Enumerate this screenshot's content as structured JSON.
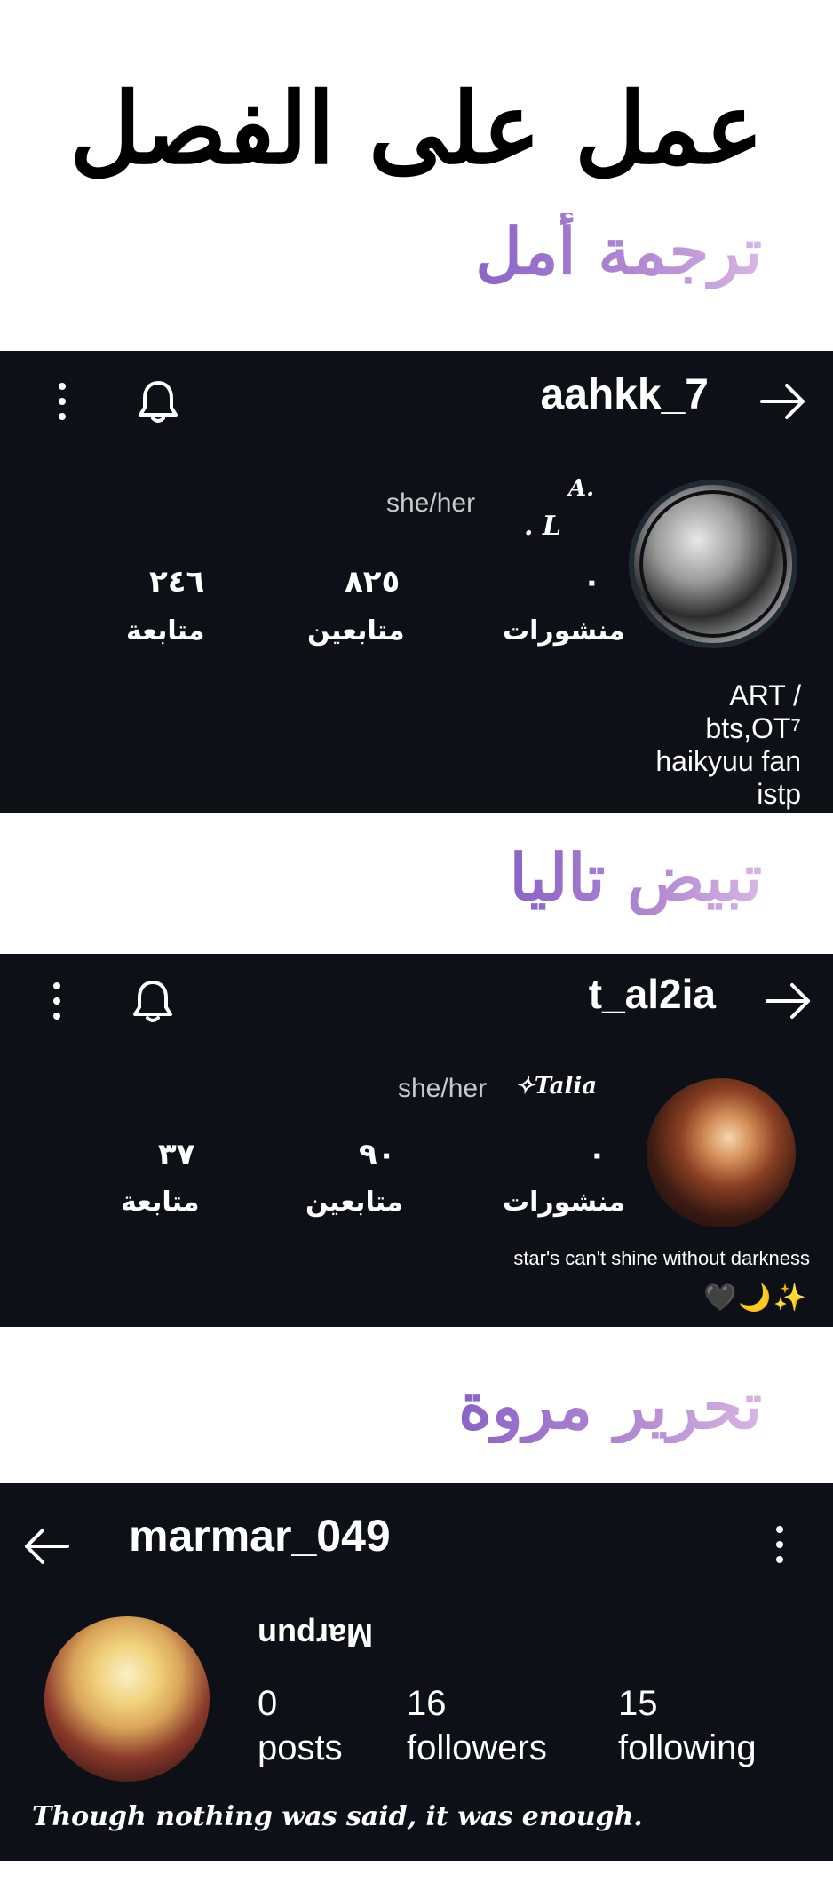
{
  "heading": "عمل على الفصل",
  "credits": {
    "translation": "ترجمة أمل",
    "whitening": "تبيض تاليا",
    "editing": "تحرير مروة"
  },
  "profile_1": {
    "username": "aahkk_7",
    "display_name_line1": "A.",
    "display_name_line2": ". L",
    "pronouns": "she/her",
    "posts_count": "٠",
    "posts_label": "منشورات",
    "followers_count": "٨٢٥",
    "followers_label": "متابعين",
    "following_count": "٢٤٦",
    "following_label": "متابعة",
    "bio": [
      "ART /",
      "bts,OT⁷",
      "haikyuu fan",
      "istp"
    ]
  },
  "profile_2": {
    "username": "t_al2ia",
    "display_name": "✧Talia",
    "pronouns": "she/her",
    "posts_count": "٠",
    "posts_label": "منشورات",
    "followers_count": "٩٠",
    "followers_label": "متابعين",
    "following_count": "٣٧",
    "following_label": "متابعة",
    "bio": "star's can't shine without darkness",
    "emoji": "🖤🌙✨"
  },
  "profile_3": {
    "username": "marmar_049",
    "display_name": "Marpun",
    "posts_count": "0",
    "posts_label": "posts",
    "followers_count": "16",
    "followers_label": "followers",
    "following_count": "15",
    "following_label": "following",
    "quote": "Though nothing was said, it was enough."
  },
  "colors": {
    "card_bg": "#0d1117",
    "credit_gradient_start": "#8a63c7",
    "credit_gradient_end": "#d8b6e4"
  }
}
